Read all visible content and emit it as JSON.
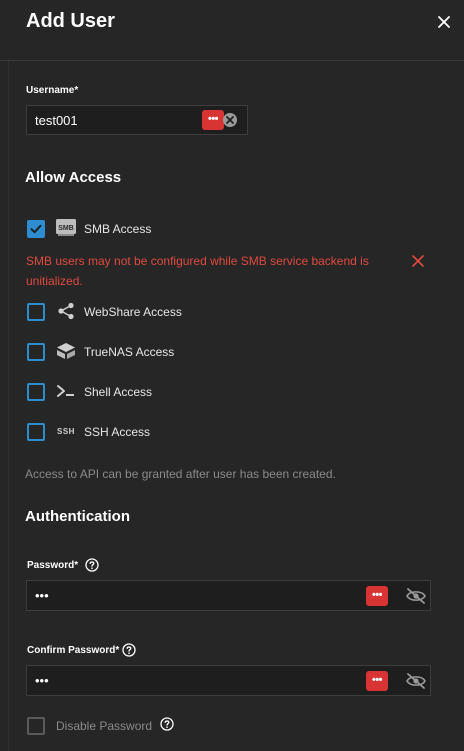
{
  "dialog": {
    "title": "Add User"
  },
  "username": {
    "label": "Username",
    "required_mark": "*",
    "value": "test001",
    "badge": "•••"
  },
  "allow_access": {
    "title": "Allow Access",
    "items": [
      {
        "label": "SMB Access",
        "checked": true,
        "icon": "smb-icon"
      },
      {
        "label": "WebShare Access",
        "checked": false,
        "icon": "share-icon"
      },
      {
        "label": "TrueNAS Access",
        "checked": false,
        "icon": "truenas-icon"
      },
      {
        "label": "Shell Access",
        "checked": false,
        "icon": "shell-icon"
      },
      {
        "label": "SSH Access",
        "checked": false,
        "icon": "ssh-icon"
      }
    ],
    "ssh_icon_text": "SSH",
    "smb_icon_text": "SMB",
    "smb_error_line1": "SMB users may not be configured while SMB service backend is",
    "smb_error_line2": "unitialized.",
    "api_hint": "Access to API can be granted after user has been created."
  },
  "authentication": {
    "title": "Authentication",
    "password": {
      "label": "Password",
      "required_mark": "*",
      "value": "•••",
      "badge": "•••"
    },
    "confirm_password": {
      "label": "Confirm Password",
      "required_mark": "*",
      "value": "•••",
      "badge": "•••"
    },
    "disable_password": {
      "label": "Disable Password",
      "checked": false
    }
  },
  "colors": {
    "accent": "#2d8dd0",
    "error": "#e04a3f",
    "badge": "#d83434",
    "background": "#262626"
  }
}
